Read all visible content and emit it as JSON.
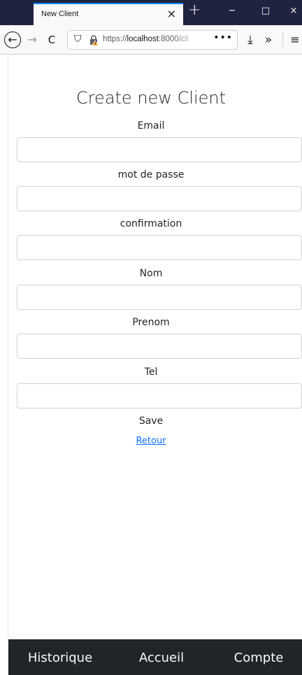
{
  "browser": {
    "tab_title": "New Client",
    "tab_close_glyph": "×",
    "new_tab_glyph": "+",
    "window_controls": {
      "minimize": "−",
      "maximize": "□",
      "close": "×"
    },
    "nav": {
      "back_glyph": "←",
      "forward_glyph": "→",
      "reload_glyph": "C"
    },
    "url": {
      "prefix": "https://",
      "host": "localhost",
      "rest": ":8000/cli"
    },
    "url_more_glyph": "•••",
    "icons": {
      "shield": "shield-icon",
      "lock": "lock-warning-icon",
      "download": "download-icon",
      "overflow": "chevron-double-right-icon",
      "menu": "hamburger-menu-icon"
    },
    "toolbar_glyphs": {
      "shield": "⛉",
      "download": "⤓",
      "overflow": "»",
      "menu": "≡"
    }
  },
  "form": {
    "title": "Create new Client",
    "fields": [
      {
        "label": "Email",
        "value": ""
      },
      {
        "label": "mot de passe",
        "value": ""
      },
      {
        "label": "confirmation",
        "value": ""
      },
      {
        "label": "Nom",
        "value": ""
      },
      {
        "label": "Prenom",
        "value": ""
      },
      {
        "label": "Tel",
        "value": ""
      }
    ],
    "save_label": "Save",
    "back_label": "Retour"
  },
  "bottom_nav": {
    "items": [
      {
        "label": "Historique"
      },
      {
        "label": "Accueil"
      },
      {
        "label": "Compte"
      }
    ]
  },
  "colors": {
    "titlebar": "#202340",
    "accent_tab": "#0a84ff",
    "link": "#0d6efd",
    "bottom_nav_bg": "#212529",
    "bottom_nav_text": "#f8f9fa"
  }
}
